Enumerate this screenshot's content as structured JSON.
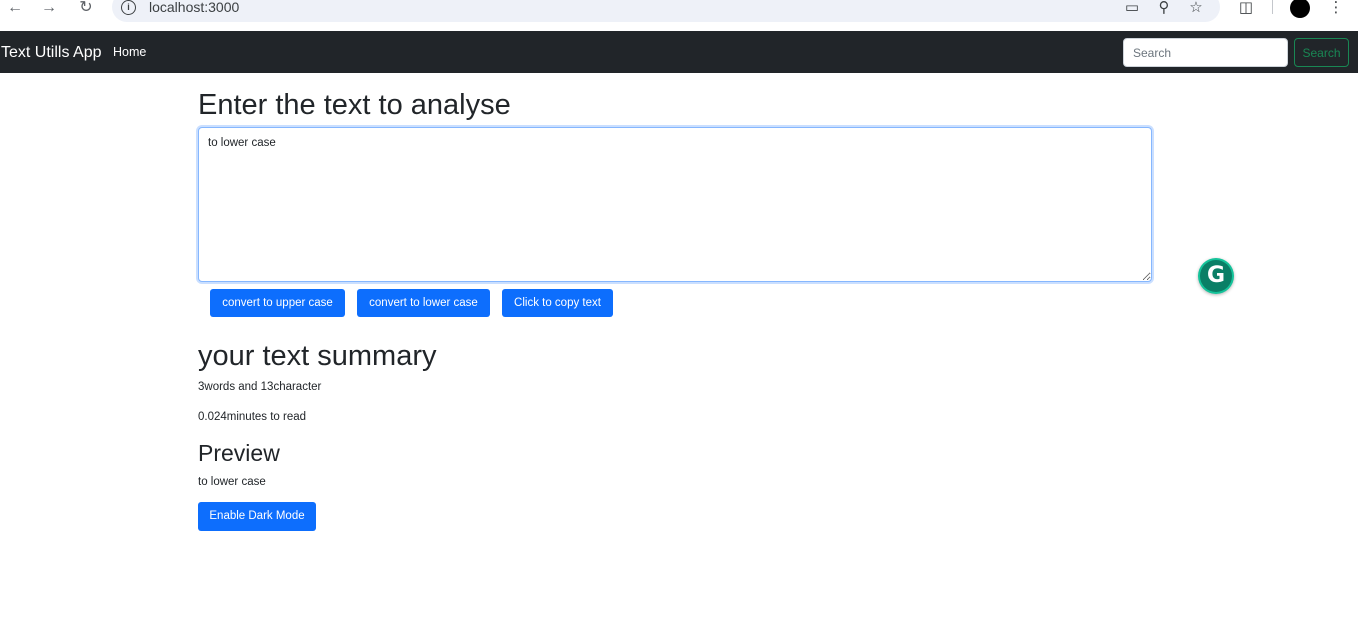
{
  "browser": {
    "url": "localhost:3000",
    "icons": [
      "back-arrow-icon",
      "forward-arrow-icon",
      "reload-icon",
      "site-info-icon",
      "install-app-icon",
      "zoom-icon",
      "bookmark-star-icon",
      "extensions-icon",
      "profile-icon",
      "menu-kebab-icon"
    ]
  },
  "navbar": {
    "brand": "Text Utills App",
    "links": [
      {
        "label": "Home"
      }
    ],
    "search": {
      "placeholder": "Search",
      "value": ""
    },
    "search_button": "Search"
  },
  "main": {
    "heading": "Enter the text to analyse",
    "textarea_value": "to lower case",
    "buttons": {
      "upper": "convert to upper case",
      "lower": "convert to lower case",
      "copy": "Click to copy text"
    },
    "summary_heading": "your text summary",
    "summary_counts": "3words and 13character",
    "summary_time": "0.024minutes to read",
    "preview_heading": "Preview",
    "preview_text": "to lower case",
    "dark_mode_button": "Enable Dark Mode"
  },
  "extension": {
    "grammarly_letter": "G"
  },
  "colors": {
    "navbar_bg": "#212529",
    "primary": "#0d6efd",
    "success": "#198754",
    "grammarly": "#15c39a"
  }
}
